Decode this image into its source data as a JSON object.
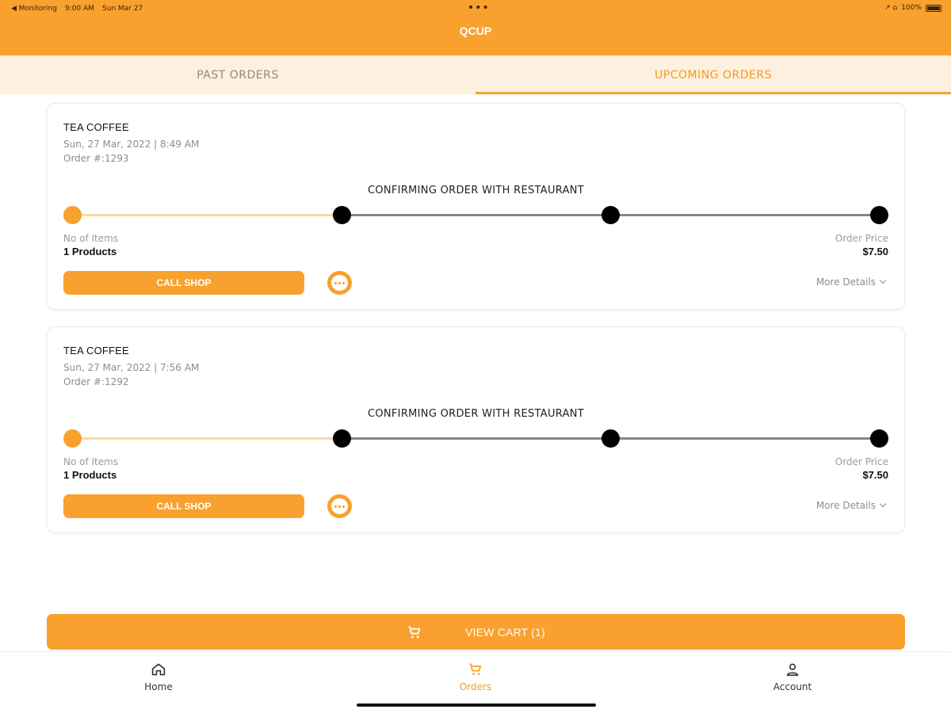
{
  "status_bar": {
    "back_app": "◀ Monitoring",
    "time": "9:00 AM",
    "date": "Sun Mar 27",
    "dots": "•••",
    "icons": "↗ ⌂",
    "battery": "100%"
  },
  "header": {
    "title": "QCUP"
  },
  "tabs": [
    {
      "label": "PAST ORDERS",
      "active": false
    },
    {
      "label": "UPCOMING ORDERS",
      "active": true
    }
  ],
  "orders": [
    {
      "shop_name": "TEA COFFEE",
      "date_time": "Sun, 27 Mar, 2022 | 8:49 AM",
      "order_number": "Order #:1293",
      "status": "CONFIRMING ORDER WITH RESTAURANT",
      "items_label": "No of Items",
      "items_value": "1 Products",
      "price_label": "Order Price",
      "price_value": "$7.50",
      "call_label": "CALL SHOP",
      "details_label": "More Details"
    },
    {
      "shop_name": "TEA COFFEE",
      "date_time": "Sun, 27 Mar, 2022 | 7:56 AM",
      "order_number": "Order #:1292",
      "status": "CONFIRMING ORDER WITH RESTAURANT",
      "items_label": "No of Items",
      "items_value": "1 Products",
      "price_label": "Order Price",
      "price_value": "$7.50",
      "call_label": "CALL SHOP",
      "details_label": "More Details"
    }
  ],
  "cart": {
    "label": "VIEW CART (1)"
  },
  "bottom_nav": [
    {
      "label": "Home",
      "icon": "home-icon"
    },
    {
      "label": "Orders",
      "icon": "cart-icon",
      "active": true
    },
    {
      "label": "Account",
      "icon": "account-icon"
    }
  ],
  "colors": {
    "accent": "#f8a12e",
    "tab_background": "#fdf0df",
    "inactive_step": "#000000",
    "completed_line": "#fbd9a3"
  }
}
